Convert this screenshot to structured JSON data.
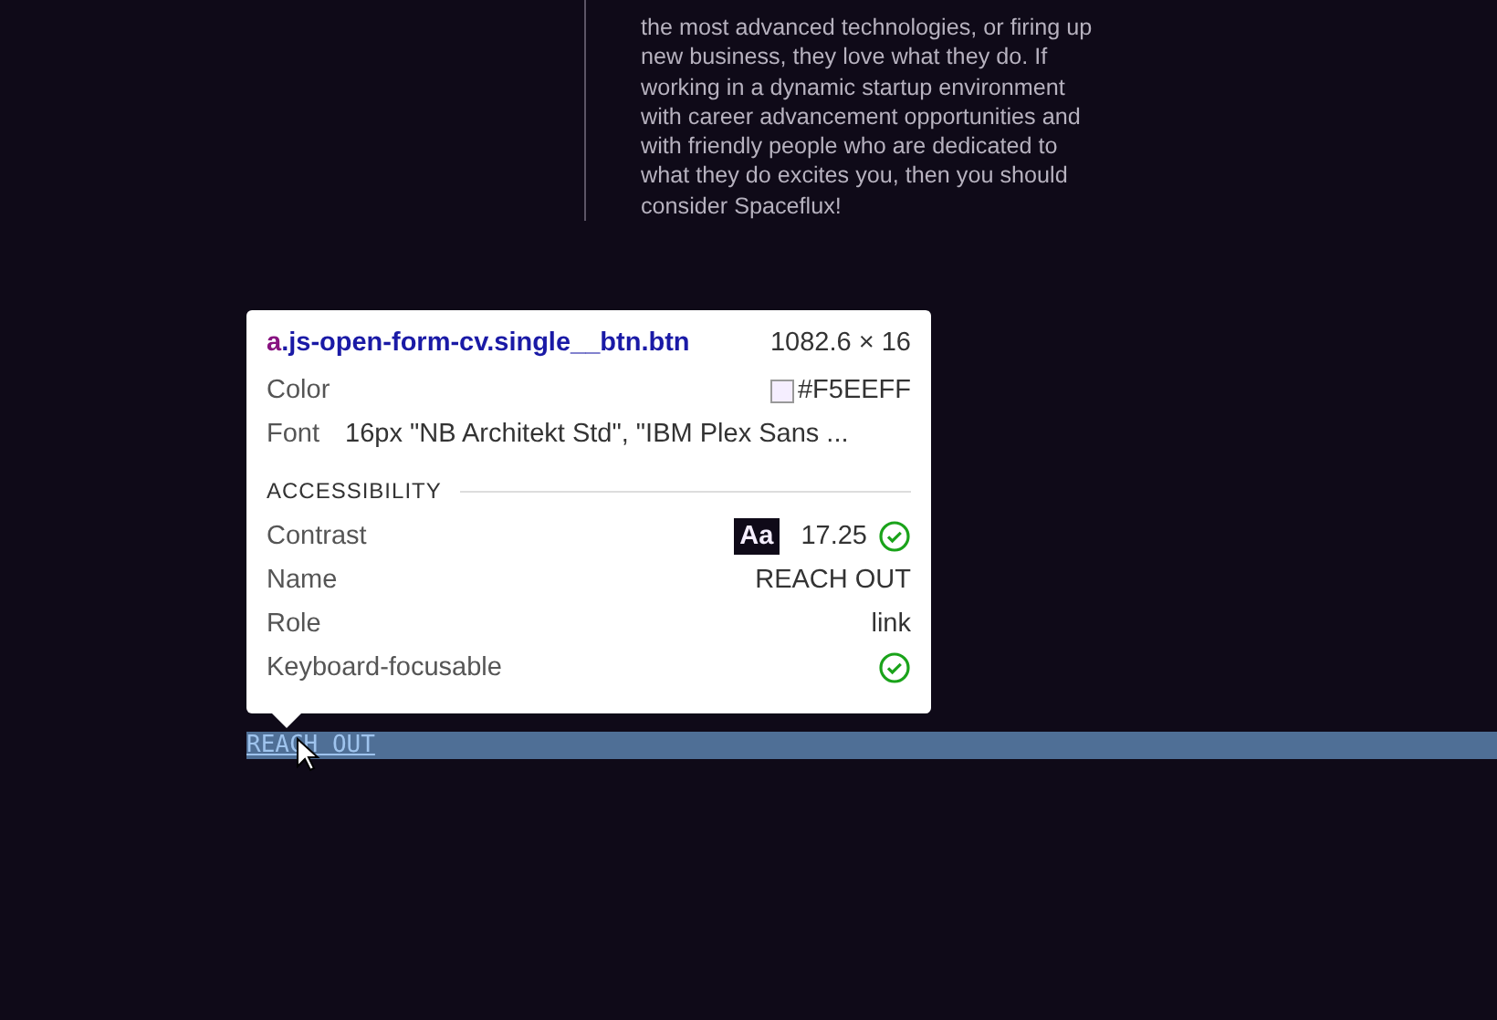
{
  "article": {
    "lines": [
      "the most advanced technologies, or firing up",
      "new business, they love what they do. If",
      "working in a dynamic startup environment",
      "with career advancement opportunities and",
      "with friendly people who are dedicated to",
      "what they do excites you, then you should",
      "consider Spaceflux!"
    ]
  },
  "tooltip": {
    "tag": "a",
    "selector": ".js-open-form-cv.single__btn.btn",
    "size": "1082.6 × 16",
    "rows": [
      {
        "kind": "color",
        "label": "Color",
        "value": "#F5EEFF",
        "color": "#f5eeff"
      },
      {
        "kind": "text",
        "label": "Font",
        "value": "16px \"NB Architekt Std\", \"IBM Plex Sans ..."
      }
    ],
    "section": "ACCESSIBILITY",
    "a11y": [
      {
        "kind": "contrast",
        "label": "Contrast",
        "sample": "Aa",
        "value": "17.25",
        "passed": true
      },
      {
        "kind": "text",
        "label": "Name",
        "value": "REACH OUT"
      },
      {
        "kind": "text",
        "label": "Role",
        "value": "link"
      },
      {
        "kind": "check",
        "label": "Keyboard-focusable",
        "passed": true
      }
    ]
  },
  "link": {
    "label": "REACH OUT",
    "highlighted": true
  }
}
